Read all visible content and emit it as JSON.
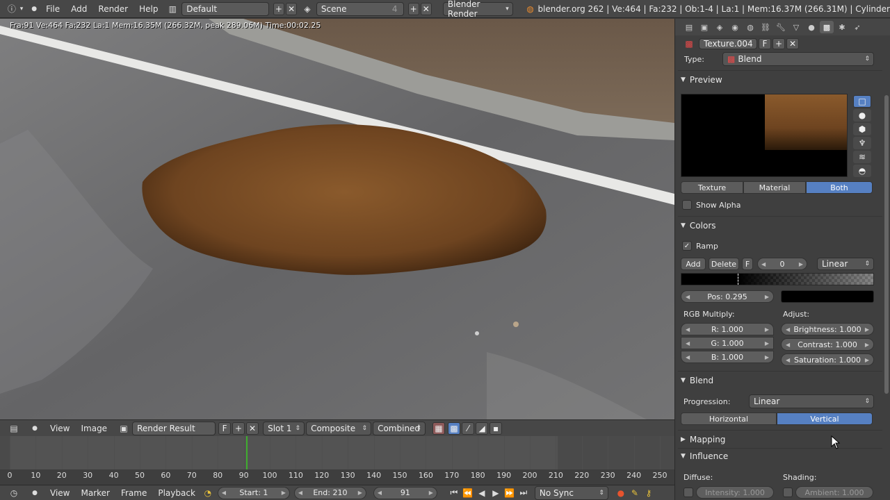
{
  "topbar": {
    "menus": [
      "File",
      "Add",
      "Render",
      "Help"
    ],
    "layout": "Default",
    "scene": "Scene",
    "scene_users": "4",
    "engine": "Blender Render",
    "info": "blender.org 262 | Ve:464 | Fa:232 | Ob:1-4 | La:1 | Mem:16.37M (266.31M) | Cylinder"
  },
  "viewport": {
    "stats": "Fra:91  Ve:464 Fa:232 La:1 Mem:16.35M (266.32M, peak 289.06M) Time:00:02.25"
  },
  "image_editor": {
    "menus": [
      "View",
      "Image"
    ],
    "image_name": "Render Result",
    "fake_user": "F",
    "slot": "Slot 1",
    "pass": "Composite",
    "layer": "Combined"
  },
  "timeline": {
    "ticks": [
      "0",
      "10",
      "20",
      "30",
      "40",
      "50",
      "60",
      "70",
      "80",
      "90",
      "100",
      "110",
      "120",
      "130",
      "140",
      "150",
      "160",
      "170",
      "180",
      "190",
      "200",
      "210",
      "220",
      "230",
      "240",
      "250"
    ],
    "menus": [
      "View",
      "Marker",
      "Frame",
      "Playback"
    ],
    "start": "Start: 1",
    "end": "End: 210",
    "current": "91",
    "sync": "No Sync"
  },
  "properties": {
    "texture_name": "Texture.004",
    "fake_user": "F",
    "type_label": "Type:",
    "type_value": "Blend",
    "preview": {
      "title": "Preview",
      "tabs": [
        "Texture",
        "Material",
        "Both"
      ],
      "selected": "Both",
      "show_alpha": "Show Alpha"
    },
    "colors": {
      "title": "Colors",
      "ramp": "Ramp",
      "add": "Add",
      "delete": "Delete",
      "flip": "F",
      "index": "0",
      "interp": "Linear",
      "pos": "Pos: 0.295",
      "rgb_label": "RGB Multiply:",
      "adjust_label": "Adjust:",
      "r": "R: 1.000",
      "g": "G: 1.000",
      "b": "B: 1.000",
      "brightness": "Brightness: 1.000",
      "contrast": "Contrast: 1.000",
      "saturation": "Saturation: 1.000"
    },
    "blend": {
      "title": "Blend",
      "progression_label": "Progression:",
      "progression": "Linear",
      "horizontal": "Horizontal",
      "vertical": "Vertical",
      "selected": "Vertical"
    },
    "mapping_title": "Mapping",
    "influence": {
      "title": "Influence",
      "diffuse": "Diffuse:",
      "shading": "Shading:",
      "intensity": "Intensity: 1.000",
      "ambient": "Ambient: 1.000"
    }
  }
}
